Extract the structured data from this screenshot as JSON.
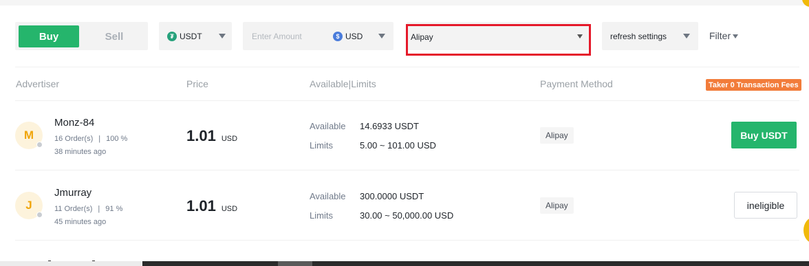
{
  "filters": {
    "trade_side": {
      "buy_label": "Buy",
      "sell_label": "Sell",
      "selected": "Buy"
    },
    "asset": {
      "value": "USDT",
      "icon": "usdt-coin-icon"
    },
    "amount": {
      "placeholder": "Enter Amount",
      "currency": "USD",
      "icon": "usd-coin-icon"
    },
    "payment": {
      "value": "Alipay"
    },
    "refresh": {
      "value": "refresh settings"
    },
    "filter_label": "Filter"
  },
  "table": {
    "headers": {
      "advertiser": "Advertiser",
      "price": "Price",
      "available_limits": "Available|Limits",
      "payment_method": "Payment Method"
    },
    "promo_badge": "Taker 0 Transaction Fees",
    "available_label": "Available",
    "limits_label": "Limits",
    "rows": [
      {
        "initial": "M",
        "name": "Monz-84",
        "orders": "16 Order(s)",
        "separator": "|",
        "completion": "100 %",
        "last_seen": "38 minutes ago",
        "price": "1.01",
        "price_currency": "USD",
        "available": "14.6933 USDT",
        "limits": "5.00 ~ 101.00 USD",
        "payment": "Alipay",
        "action": "Buy USDT"
      },
      {
        "initial": "J",
        "name": "Jmurray",
        "orders": "11 Order(s)",
        "separator": "|",
        "completion": "91 %",
        "last_seen": "45 minutes ago",
        "price": "1.01",
        "price_currency": "USD",
        "available": "300.0000 USDT",
        "limits": "30.00 ~ 50,000.00 USD",
        "payment": "Alipay",
        "action": "ineligible"
      }
    ]
  },
  "colors": {
    "accent_green": "#25b56c",
    "highlight_red": "#e5192a",
    "promo_orange": "#f27c3a",
    "avatar_gold": "#f0a50b"
  }
}
